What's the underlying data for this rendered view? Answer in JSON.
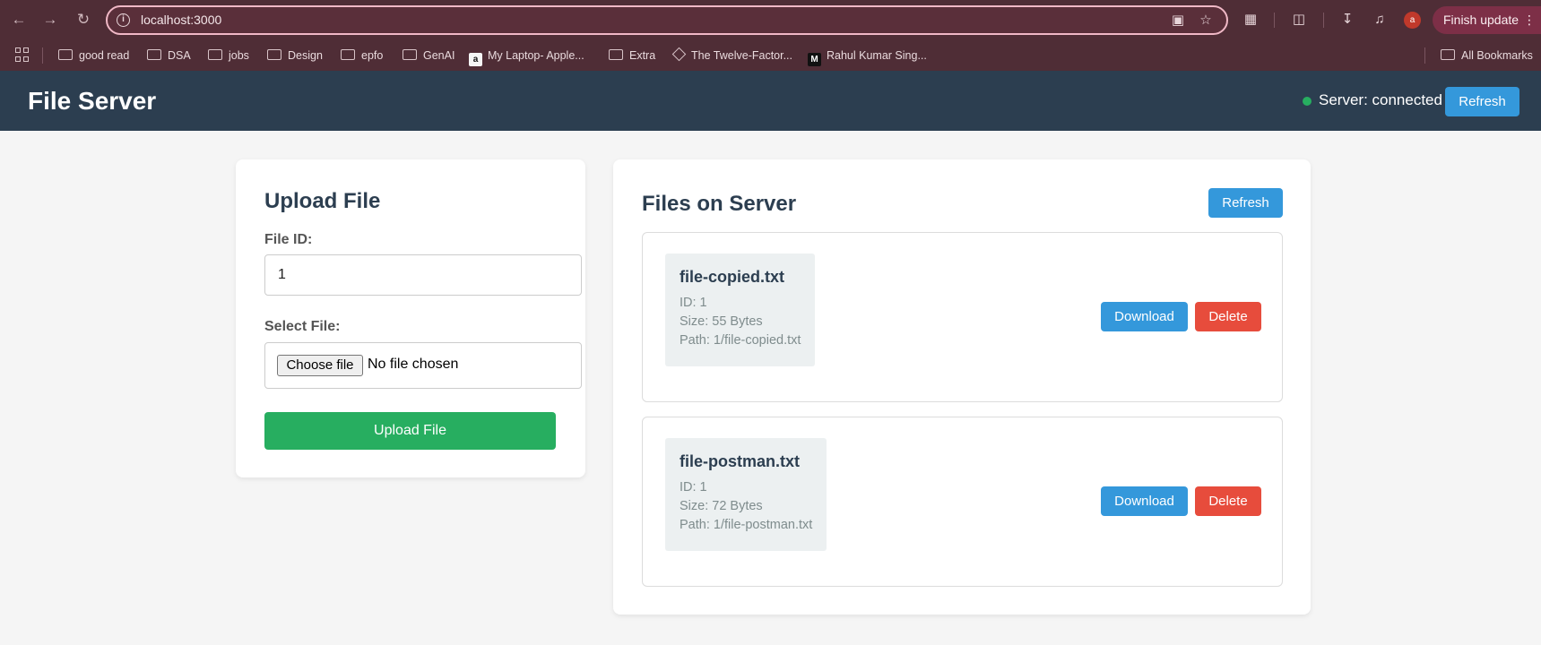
{
  "browser": {
    "url": "localhost:3000",
    "finish_update": "Finish update",
    "avatar_letter": "a",
    "bookmarks": [
      {
        "label": "good read",
        "icon": "folder-icon"
      },
      {
        "label": "DSA",
        "icon": "folder-icon"
      },
      {
        "label": "jobs",
        "icon": "folder-icon"
      },
      {
        "label": "Design",
        "icon": "folder-icon"
      },
      {
        "label": "epfo",
        "icon": "folder-icon"
      },
      {
        "label": "GenAI",
        "icon": "folder-icon"
      },
      {
        "label": "My Laptop- Apple...",
        "icon": "amazon-icon"
      },
      {
        "label": "Extra",
        "icon": "folder-icon"
      },
      {
        "label": "The Twelve-Factor...",
        "icon": "diamond-icon"
      },
      {
        "label": "Rahul Kumar Sing...",
        "icon": "medium-icon"
      }
    ],
    "all_bookmarks": "All Bookmarks",
    "amazon_glyph": "a",
    "medium_glyph": "M"
  },
  "header": {
    "title": "File Server",
    "status": "Server: connected",
    "refresh_label": "Refresh",
    "status_color": "#27ae60"
  },
  "upload": {
    "title": "Upload File",
    "file_id_label": "File ID:",
    "file_id_value": "1",
    "select_file_label": "Select File:",
    "choose_file_label": "Choose file",
    "no_file_text": "No file chosen",
    "upload_button": "Upload File"
  },
  "files": {
    "title": "Files on Server",
    "refresh_label": "Refresh",
    "download_label": "Download",
    "delete_label": "Delete",
    "items": [
      {
        "name": "file-copied.txt",
        "id": "ID: 1",
        "size": "Size: 55 Bytes",
        "path": "Path: 1/file-copied.txt"
      },
      {
        "name": "file-postman.txt",
        "id": "ID: 1",
        "size": "Size: 72 Bytes",
        "path": "Path: 1/file-postman.txt"
      }
    ]
  },
  "colors": {
    "header_bg": "#2c3e50",
    "primary": "#3498db",
    "danger": "#e74c3c",
    "success": "#27ae60"
  }
}
